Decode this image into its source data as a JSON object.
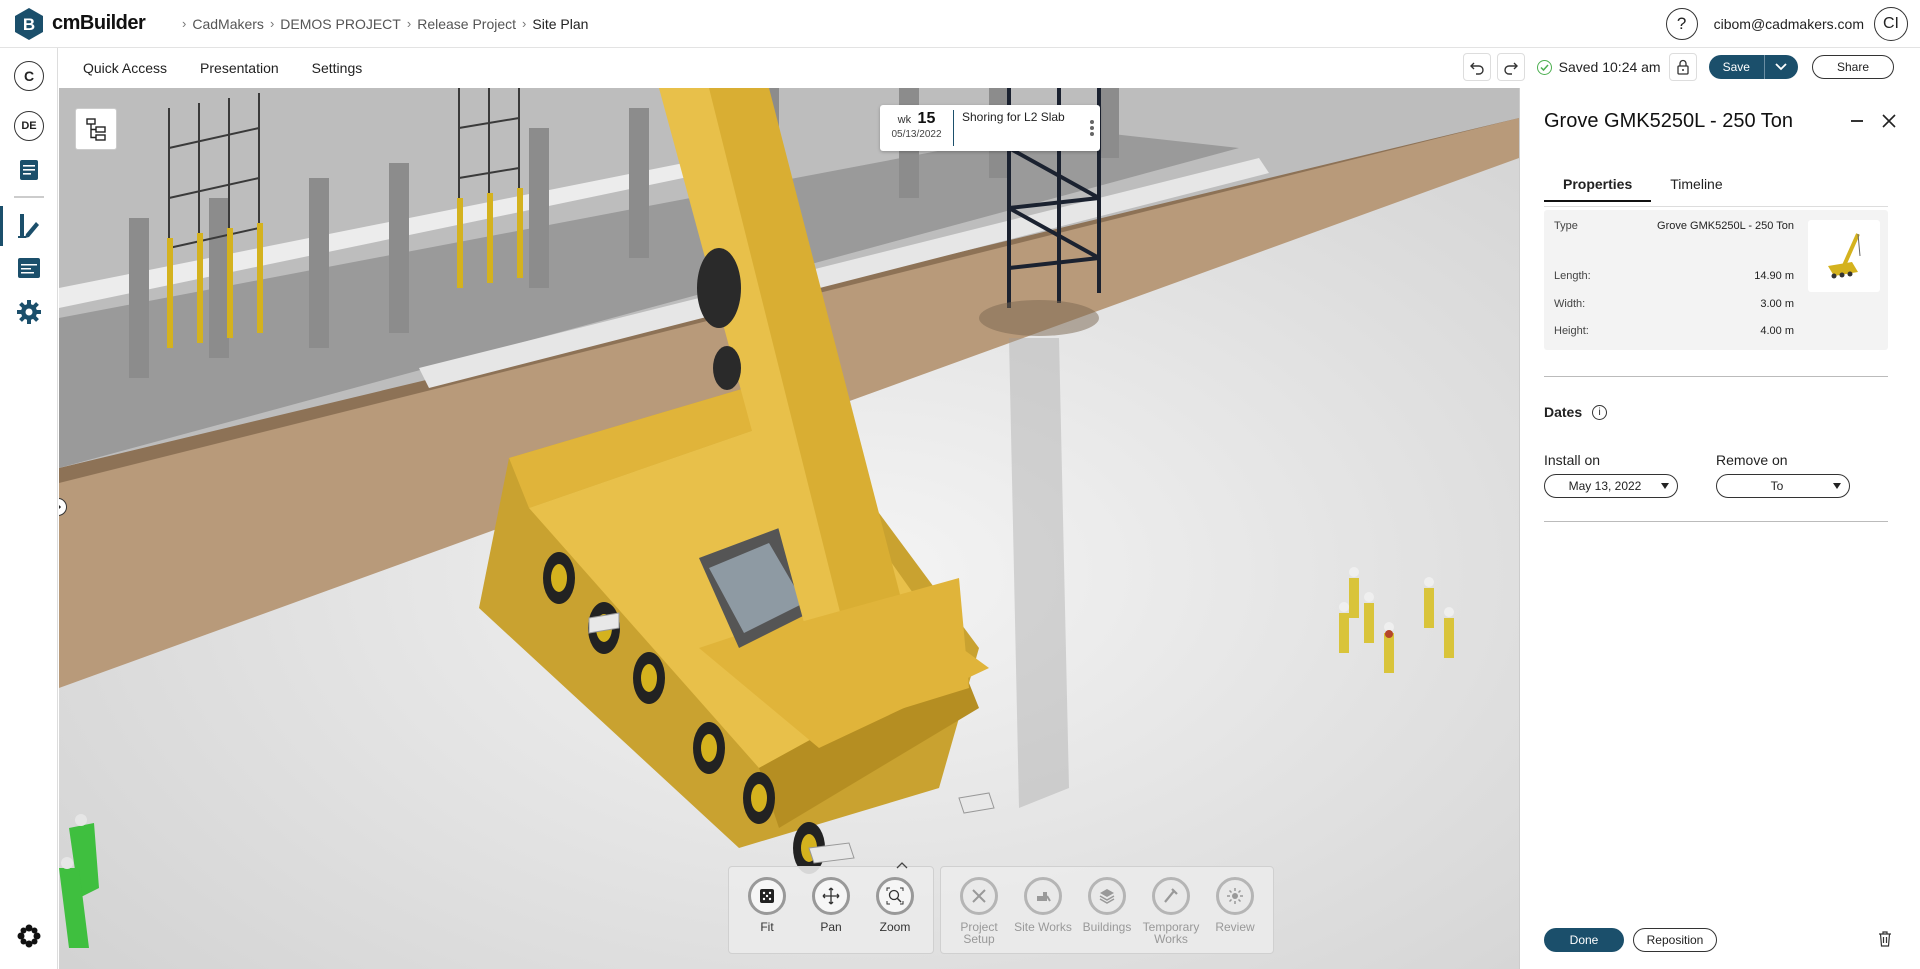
{
  "app": {
    "name": "cmBuilder",
    "logo_letter": "B"
  },
  "breadcrumb": [
    "CadMakers",
    "DEMOS PROJECT",
    "Release Project",
    "Site Plan"
  ],
  "user": {
    "email": "cibom@cadmakers.com",
    "initials": "CI"
  },
  "help_icon": "?",
  "rail": {
    "items": [
      {
        "name": "company-logo",
        "text": "C"
      },
      {
        "name": "language",
        "text": "DE"
      },
      {
        "name": "document-icon"
      },
      {
        "name": "design-icon",
        "active": true
      },
      {
        "name": "schedule-icon"
      },
      {
        "name": "settings-icon"
      },
      {
        "name": "apps-icon"
      }
    ]
  },
  "toolbar": {
    "menus": [
      "Quick Access",
      "Presentation",
      "Settings"
    ],
    "saved_text": "Saved 10:24 am",
    "save_label": "Save",
    "share_label": "Share"
  },
  "schedule_badge": {
    "week_label": "wk",
    "week_number": "15",
    "date": "05/13/2022",
    "task": "Shoring for L2 Slab"
  },
  "view_tools": [
    {
      "label": "Fit",
      "icon": "fit-icon"
    },
    {
      "label": "Pan",
      "icon": "pan-icon"
    },
    {
      "label": "Zoom",
      "icon": "zoom-icon"
    }
  ],
  "mode_tools": [
    {
      "label": "Project Setup",
      "icon": "project-setup-icon"
    },
    {
      "label": "Site Works",
      "icon": "site-works-icon"
    },
    {
      "label": "Buildings",
      "icon": "buildings-icon"
    },
    {
      "label": "Temporary Works",
      "icon": "temporary-works-icon"
    },
    {
      "label": "Review",
      "icon": "review-icon"
    }
  ],
  "panel": {
    "title": "Grove GMK5250L - 250 Ton",
    "tabs": [
      "Properties",
      "Timeline"
    ],
    "properties": {
      "type_label": "Type",
      "type_value": "Grove GMK5250L - 250 Ton",
      "length_label": "Length:",
      "length_value": "14.90 m",
      "width_label": "Width:",
      "width_value": "3.00 m",
      "height_label": "Height:",
      "height_value": "4.00 m"
    },
    "dates_title": "Dates",
    "install_label": "Install on",
    "install_value": "May 13, 2022",
    "remove_label": "Remove on",
    "remove_value": "To",
    "done_label": "Done",
    "reposition_label": "Reposition"
  },
  "colors": {
    "accent": "#1b4f6b",
    "crane_yellow": "#e0b43a",
    "saved_green": "#4caf50"
  }
}
